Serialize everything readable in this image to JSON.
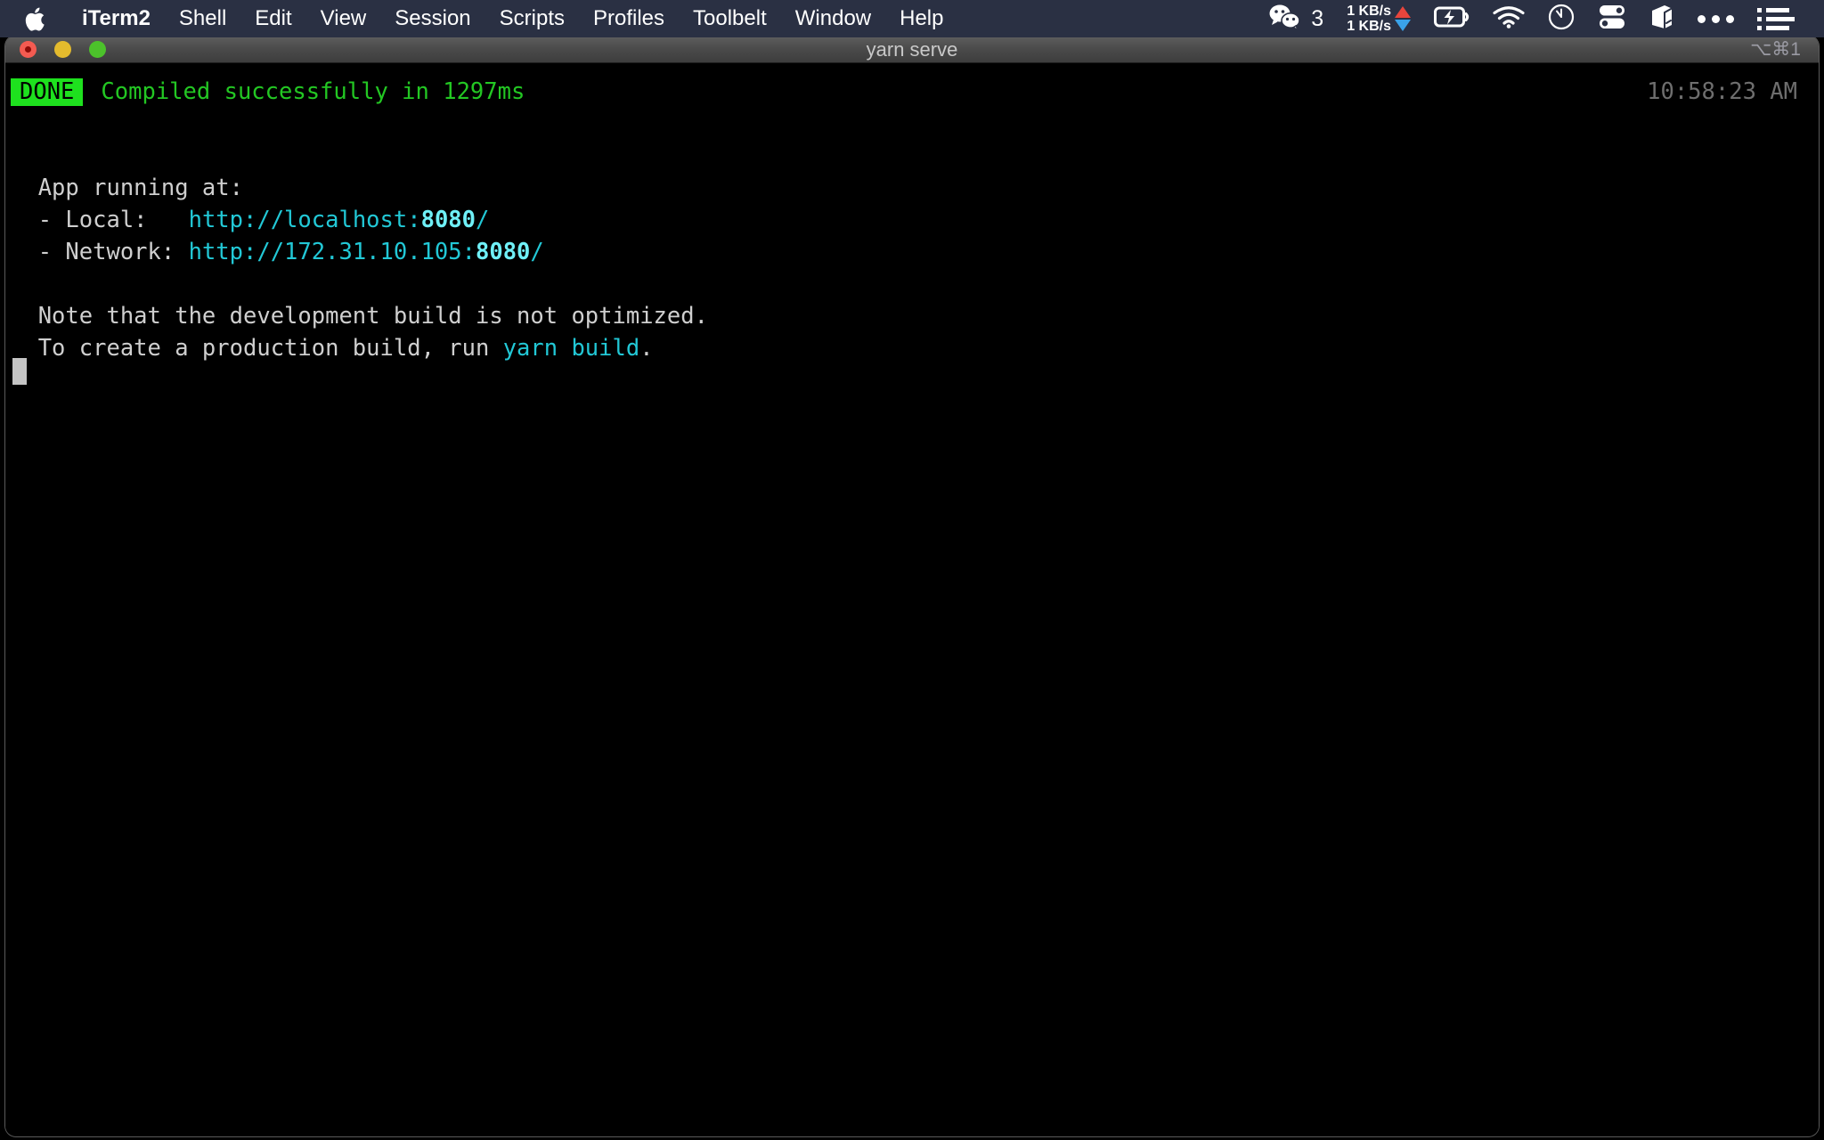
{
  "menubar": {
    "apple_icon": "apple-logo-icon",
    "items": [
      {
        "label": "iTerm2",
        "bold": true
      },
      {
        "label": "Shell",
        "bold": false
      },
      {
        "label": "Edit",
        "bold": false
      },
      {
        "label": "View",
        "bold": false
      },
      {
        "label": "Session",
        "bold": false
      },
      {
        "label": "Scripts",
        "bold": false
      },
      {
        "label": "Profiles",
        "bold": false
      },
      {
        "label": "Toolbelt",
        "bold": false
      },
      {
        "label": "Window",
        "bold": false
      },
      {
        "label": "Help",
        "bold": false
      }
    ],
    "status": {
      "wechat_icon": "wechat-icon",
      "wechat_badge": "3",
      "network_up": "1 KB/s",
      "network_down": "1 KB/s",
      "up_arrow_color": "#e8453c",
      "down_arrow_color": "#3aa2e8",
      "battery_icon": "battery-charging-icon",
      "wifi_icon": "wifi-icon",
      "clock_icon": "clock-icon",
      "control_center_icon": "control-center-icon",
      "package_icon": "package-icon",
      "ellipsis_icon": "ellipsis-icon",
      "notification_center_icon": "notification-center-icon"
    },
    "background": "#2a3043"
  },
  "window": {
    "title": "yarn serve",
    "shortcut": "⌥⌘1",
    "traffic_lights": {
      "close": "close-button",
      "minimize": "minimize-button",
      "maximize": "maximize-button"
    }
  },
  "terminal": {
    "status": {
      "badge": "DONE",
      "badge_bg": "#1ee11e",
      "badge_fg": "#000000",
      "message": "Compiled successfully in 1297ms",
      "message_color": "#23c723",
      "timestamp": "10:58:23 AM",
      "timestamp_color": "#6e6e6e"
    },
    "lines": [
      {
        "type": "blank",
        "segments": []
      },
      {
        "type": "blank",
        "segments": []
      },
      {
        "type": "text",
        "segments": [
          {
            "text": "  App running at:",
            "color": "white"
          }
        ]
      },
      {
        "type": "text",
        "segments": [
          {
            "text": "  - Local:   ",
            "color": "white"
          },
          {
            "text": "http://localhost:",
            "color": "cyan"
          },
          {
            "text": "8080",
            "color": "cyan-bold"
          },
          {
            "text": "/",
            "color": "cyan"
          }
        ]
      },
      {
        "type": "text",
        "segments": [
          {
            "text": "  - Network: ",
            "color": "white"
          },
          {
            "text": "http://172.31.10.105:",
            "color": "cyan"
          },
          {
            "text": "8080",
            "color": "cyan-bold"
          },
          {
            "text": "/",
            "color": "cyan"
          }
        ]
      },
      {
        "type": "blank",
        "segments": []
      },
      {
        "type": "text",
        "segments": [
          {
            "text": "  Note that the development build is not optimized.",
            "color": "white"
          }
        ]
      },
      {
        "type": "text",
        "segments": [
          {
            "text": "  To create a production build, run ",
            "color": "white"
          },
          {
            "text": "yarn build",
            "color": "cyan"
          },
          {
            "text": ".",
            "color": "white"
          }
        ]
      }
    ],
    "cursor": "block-cursor",
    "background": "#000000",
    "default_text_color": "#cfcfcf",
    "link_color": "#22c8d6"
  }
}
